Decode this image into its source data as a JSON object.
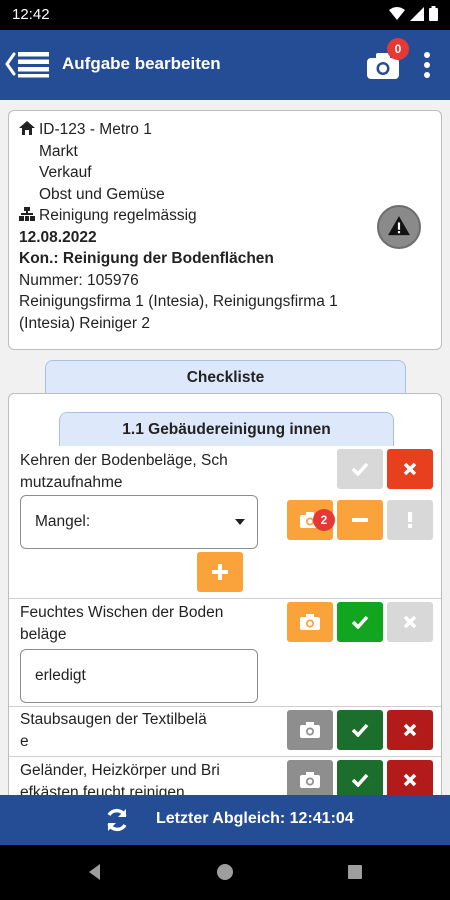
{
  "status_bar": {
    "time": "12:42"
  },
  "app_bar": {
    "title": "Aufgabe bearbeiten",
    "photo_count": "0"
  },
  "info": {
    "location_lines": [
      "ID-123 - Metro 1",
      "Markt",
      "Verkauf",
      "Obst und Gemüse"
    ],
    "task_type": "Reinigung regelmässig",
    "date": "12.08.2022",
    "control": "Kon.: Reinigung der Bodenflächen",
    "number": "Nummer: 105976",
    "company_line1": "Reinigungsfirma 1 (Intesia), Reinigungsfirma 1",
    "company_line2": "(Intesia) Reiniger 2"
  },
  "checklist": {
    "tab_label": "Checkliste",
    "section_label": "1.1 Gebäudereinigung innen",
    "items": [
      {
        "text_lines": [
          "Kehren der Bodenbeläge, Sch",
          "mutzaufnahme"
        ],
        "select_value": "Mangel:",
        "photo_count": "2"
      },
      {
        "text_lines": [
          "Feuchtes Wischen der Boden",
          "beläge"
        ],
        "input_value": "erledigt"
      },
      {
        "text_lines": [
          "Staubsaugen der Textilbelä",
          "e"
        ]
      },
      {
        "text_lines": [
          "Geländer, Heizkörper und Bri",
          "efkästen feucht reinigen"
        ]
      }
    ]
  },
  "bottom_bar": {
    "sync_label": "Letzter Abgleich: 12:41:04"
  },
  "colors": {
    "primary": "#244d96",
    "orange": "#f9a33a",
    "green": "#12a520",
    "dark_green": "#1b6e2c",
    "red": "#e8401f",
    "dark_red": "#b31b1b"
  },
  "icons": [
    "wifi-icon",
    "signal-icon",
    "battery-icon",
    "back-list-icon",
    "camera-icon",
    "more-vert-icon",
    "home-icon",
    "sitemap-icon",
    "warning-icon",
    "check-icon",
    "close-icon",
    "minus-icon",
    "exclamation-icon",
    "plus-icon",
    "sync-icon"
  ]
}
